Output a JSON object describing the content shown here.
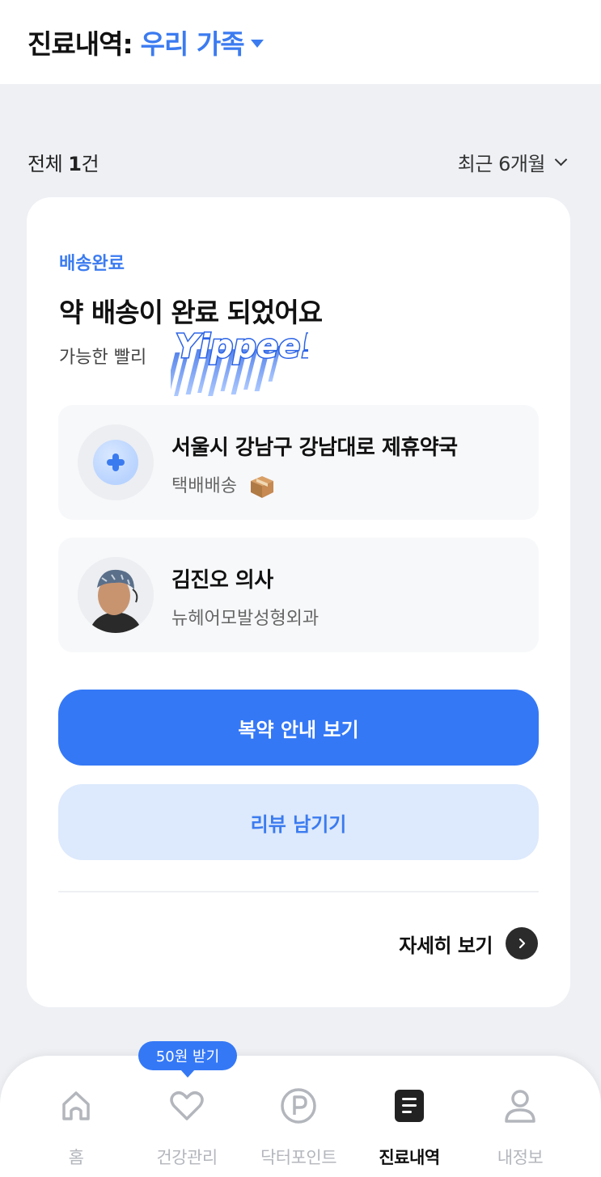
{
  "header": {
    "title": "진료내역:",
    "filter_label": "우리 가족"
  },
  "summary": {
    "total_prefix": "전체 ",
    "total_count": "1",
    "total_suffix": "건",
    "period_label": "최근 6개월"
  },
  "card": {
    "status_label": "배송완료",
    "title": "약 배송이 완료 되었어요",
    "subtitle": "가능한 빨리",
    "sticker_text": "Yippee!",
    "pharmacy": {
      "name": "서울시 강남구 강남대로 제휴약국",
      "delivery_method": "택배배송",
      "icon": "package-emoji"
    },
    "doctor": {
      "name": "김진오 의사",
      "clinic": "뉴헤어모발성형외과"
    },
    "primary_button": "복약 안내 보기",
    "secondary_button": "리뷰 남기기",
    "detail_link": "자세히 보기"
  },
  "tabbar": {
    "promo_badge": "50원 받기",
    "tabs": [
      {
        "label": "홈",
        "icon": "home-icon",
        "active": false
      },
      {
        "label": "건강관리",
        "icon": "heart-icon",
        "active": false
      },
      {
        "label": "닥터포인트",
        "icon": "point-icon",
        "active": false
      },
      {
        "label": "진료내역",
        "icon": "document-icon",
        "active": true
      },
      {
        "label": "내정보",
        "icon": "user-icon",
        "active": false
      }
    ]
  },
  "colors": {
    "accent": "#3478f6",
    "accent_text": "#3b7bf0",
    "secondary_button_bg": "#dde9fc",
    "page_bg": "#eef0f4"
  }
}
